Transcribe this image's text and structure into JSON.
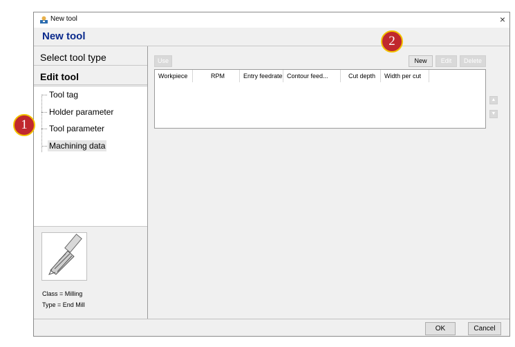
{
  "window": {
    "title": "New tool",
    "close_glyph": "×"
  },
  "header": {
    "title": "New tool"
  },
  "steps": [
    {
      "label": "Select tool type"
    },
    {
      "label": "Edit tool"
    }
  ],
  "tree": {
    "items": [
      {
        "label": "Tool tag"
      },
      {
        "label": "Holder parameter"
      },
      {
        "label": "Tool parameter"
      },
      {
        "label": "Machining data"
      }
    ]
  },
  "tool_info": {
    "class": "Class = Milling",
    "type": "Type = End Mill"
  },
  "toolbar": {
    "use": "Use",
    "new": "New",
    "edit": "Edit",
    "delete": "Delete"
  },
  "table": {
    "columns": [
      "Workpiece",
      "RPM",
      "Entry feedrate",
      "Contour feed...",
      "Cut depth",
      "Width per cut"
    ],
    "rows": []
  },
  "side_arrows": {
    "up": "▲",
    "down": "▼"
  },
  "footer": {
    "ok": "OK",
    "cancel": "Cancel"
  },
  "markers": [
    "1",
    "2"
  ],
  "colors": {
    "header_title": "#0a2a8c",
    "marker_fill": "#c0282d",
    "marker_ring": "#f2c200"
  }
}
